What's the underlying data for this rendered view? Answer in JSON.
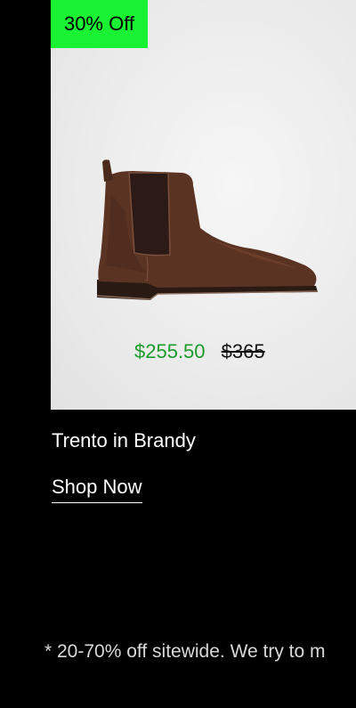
{
  "product": {
    "badge": "30% Off",
    "sale_price": "$255.50",
    "original_price": "$365",
    "name": "Trento in Brandy",
    "cta_label": "Shop Now",
    "colors": {
      "badge_bg": "#19f233",
      "sale_price": "#1a9c2b"
    },
    "image_icon": "chelsea-boot"
  },
  "footer": {
    "disclaimer": "* 20-70% off sitewide. We try to m"
  }
}
